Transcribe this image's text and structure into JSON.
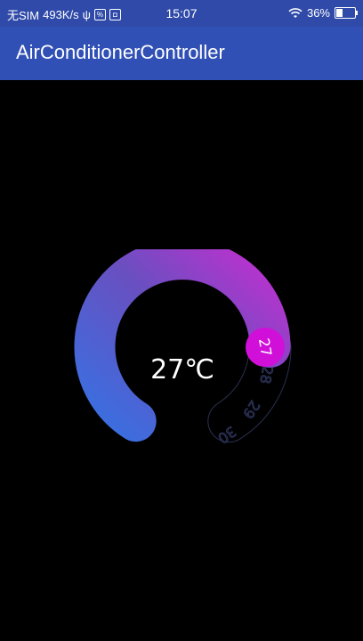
{
  "status_bar": {
    "carrier": "无SIM",
    "speed": "493K/s",
    "time": "15:07",
    "battery_text": "36%",
    "battery_level": 0.36,
    "icons": [
      "usb-icon",
      "notification-icon",
      "camera-app-icon",
      "wifi-icon",
      "battery-icon"
    ]
  },
  "app_bar": {
    "title": "AirConditionerController",
    "color": "#3050b6"
  },
  "dial": {
    "temperature_text": "27℃",
    "current_value": "27",
    "remaining_labels": [
      "28",
      "29",
      "30"
    ],
    "gradient_colors": [
      "#3a6fe0",
      "#6a4fc0",
      "#c030d0"
    ],
    "knob_color": "#d010d8"
  }
}
